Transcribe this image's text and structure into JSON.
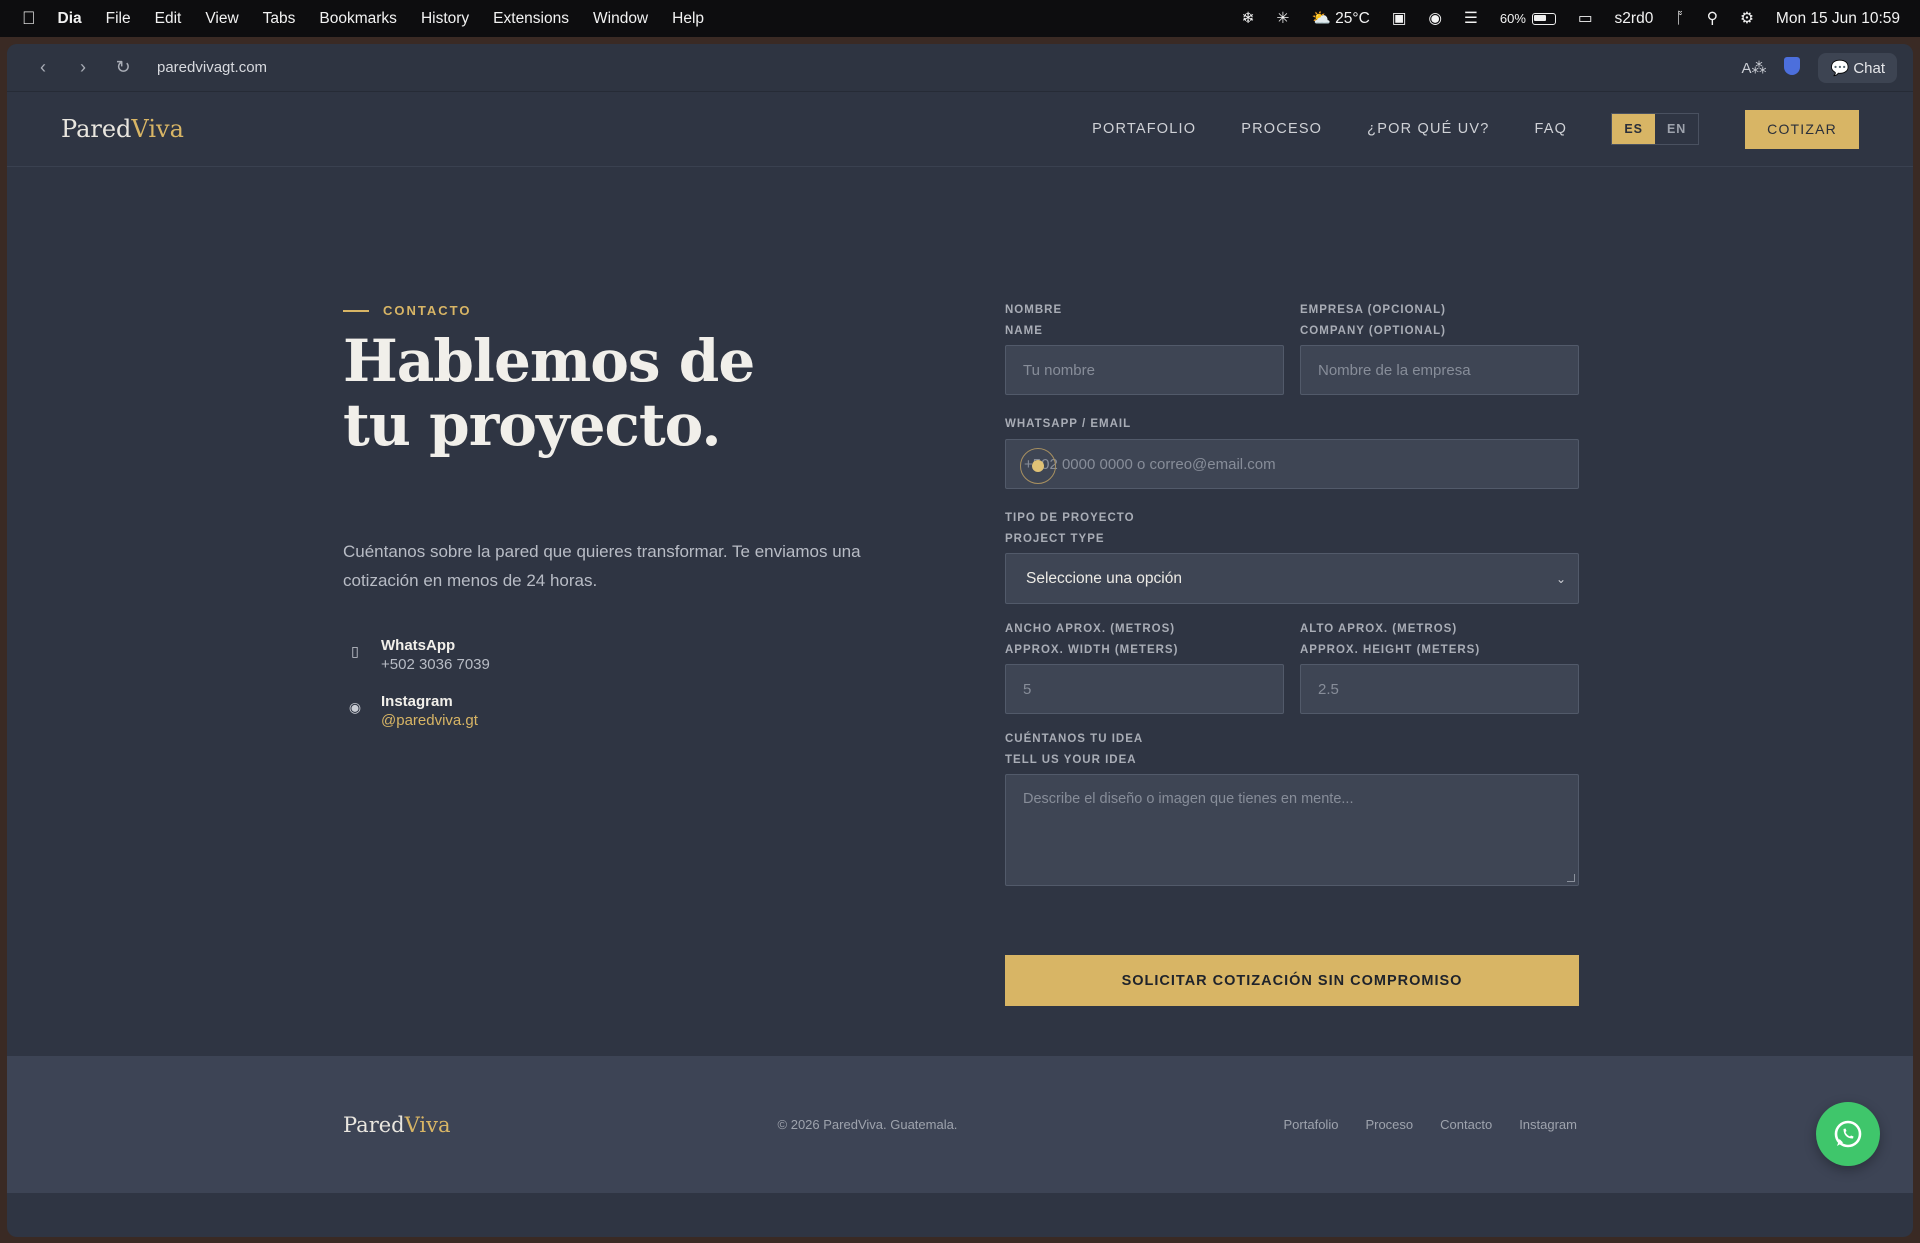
{
  "menubar": {
    "app": "Dia",
    "menus": [
      "File",
      "Edit",
      "View",
      "Tabs",
      "Bookmarks",
      "History",
      "Extensions",
      "Window",
      "Help"
    ],
    "weather": "25°C",
    "battery": "60%",
    "user": "s2rd0",
    "clock": "Mon 15 Jun  10:59"
  },
  "browser": {
    "url": "paredvivagt.com",
    "chat_label": "Chat"
  },
  "site": {
    "logo_a": "Pared",
    "logo_b": "Viva",
    "nav": [
      "PORTAFOLIO",
      "PROCESO",
      "¿POR QUÉ UV?",
      "FAQ"
    ],
    "lang_es": "ES",
    "lang_en": "EN",
    "cta": "COTIZAR"
  },
  "hero": {
    "eyebrow": "CONTACTO",
    "headline_1": "Hablemos de",
    "headline_2": "tu proyecto.",
    "lead": "Cuéntanos sobre la pared que quieres transformar. Te enviamos una cotización en menos de 24 horas.",
    "whatsapp_title": "WhatsApp",
    "whatsapp_value": "+502 3036 7039",
    "instagram_title": "Instagram",
    "instagram_value": "@paredviva.gt"
  },
  "form": {
    "name_label_es": "NOMBRE",
    "name_label_en": "NAME",
    "name_placeholder": "Tu nombre",
    "company_label_es": "EMPRESA (OPCIONAL)",
    "company_label_en": "COMPANY (OPTIONAL)",
    "company_placeholder": "Nombre de la empresa",
    "contact_label": "WHATSAPP / EMAIL",
    "contact_placeholder": "+502 0000 0000 o correo@email.com",
    "type_label_es": "TIPO DE PROYECTO",
    "type_label_en": "PROJECT TYPE",
    "type_selected": "Seleccione una opción",
    "width_label_es": "ANCHO APROX. (METROS)",
    "width_label_en": "APPROX. WIDTH (METERS)",
    "width_placeholder": "5",
    "height_label_es": "ALTO APROX. (METROS)",
    "height_label_en": "APPROX. HEIGHT (METERS)",
    "height_placeholder": "2.5",
    "idea_label_es": "CUÉNTANOS TU IDEA",
    "idea_label_en": "TELL US YOUR IDEA",
    "idea_placeholder": "Describe el diseño o imagen que tienes en mente...",
    "submit": "SOLICITAR COTIZACIÓN SIN COMPROMISO"
  },
  "footer": {
    "logo_a": "Pared",
    "logo_b": "Viva",
    "copyright": "© 2026 ParedViva. Guatemala.",
    "links": [
      "Portafolio",
      "Proceso",
      "Contacto",
      "Instagram"
    ]
  }
}
